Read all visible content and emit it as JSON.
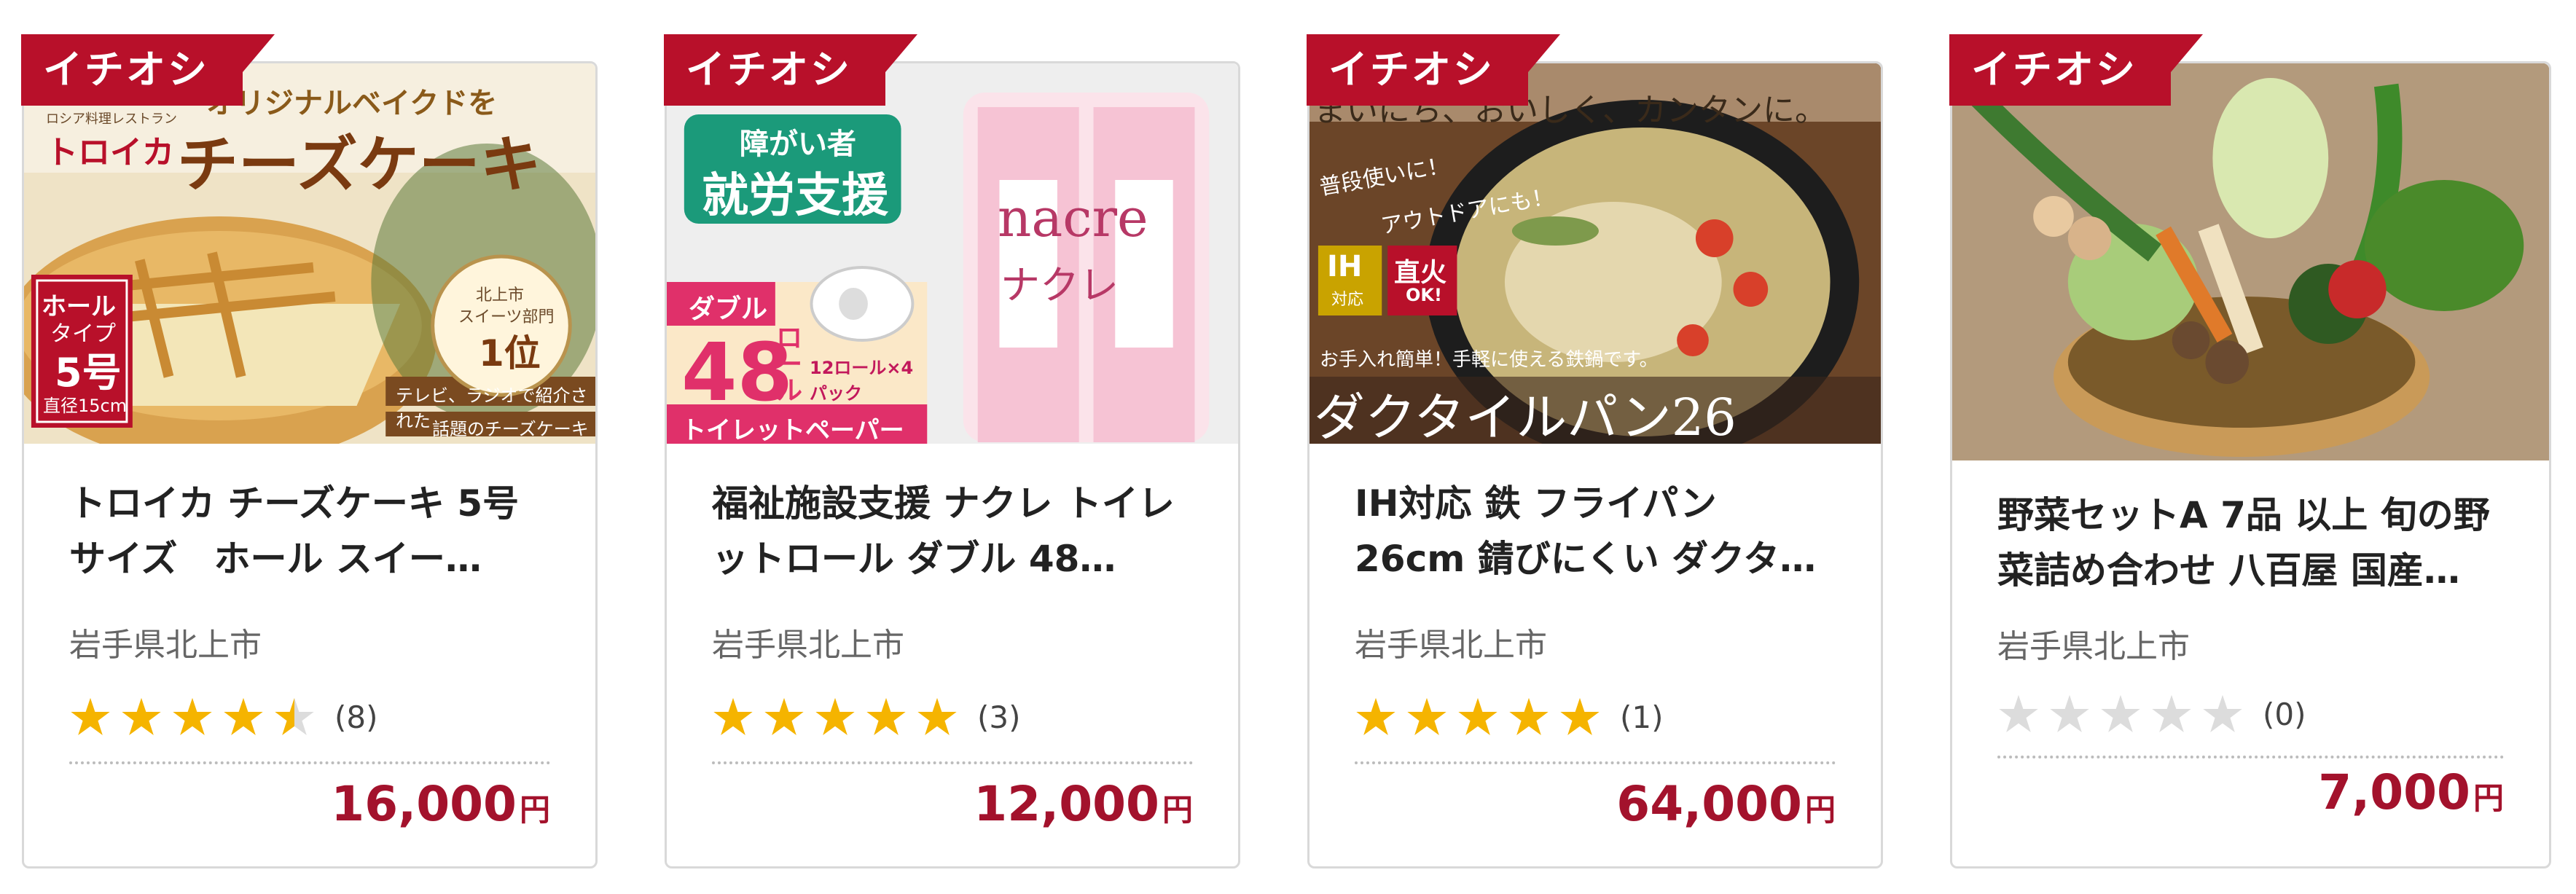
{
  "colors": {
    "accent": "#b8102a",
    "price": "#a3122c",
    "star_on": "#f5b400",
    "star_off": "#dcdcdc"
  },
  "cards": [
    {
      "ribbon": "イチオシ",
      "image_text": [
        "オリジナルベイクドを",
        "トロイカ",
        "チーズケーキ",
        "ロシア料理レストラン",
        "ホール",
        "タイプ",
        "5号",
        "直径15cm",
        "北上市",
        "スイーツ部門",
        "1位",
        "テレビ、ラジオで紹介された",
        "話題のチーズケーキ"
      ],
      "title": "トロイカ チーズケーキ 5号サイズ　ホール スイー…",
      "location": "岩手県北上市",
      "rating": 4.5,
      "review_count": "(8)",
      "price": "16,000",
      "currency": "円"
    },
    {
      "ribbon": "イチオシ",
      "image_text": [
        "障がい者",
        "就労支援",
        "ダブル",
        "48",
        "ロール",
        "12ロール×4パック",
        "トイレットペーパー",
        "nacre",
        "ナクレ"
      ],
      "title": "福祉施設支援 ナクレ トイレットロール ダブル 48…",
      "location": "岩手県北上市",
      "rating": 5,
      "review_count": "(3)",
      "price": "12,000",
      "currency": "円"
    },
    {
      "ribbon": "イチオシ",
      "image_text": [
        "まいにち、おいしく、カンタンに。",
        "普段使いに！",
        "アウトドアにも！",
        "IH",
        "対応",
        "直火",
        "OK!",
        "お手入れ簡単！手軽に使える鉄鍋です。",
        "ダクタイルパン26"
      ],
      "title": "IH対応 鉄 フライパン 26cm 錆びにくい ダクタイ…",
      "location": "岩手県北上市",
      "rating": 5,
      "review_count": "(1)",
      "price": "64,000",
      "currency": "円"
    },
    {
      "ribbon": "イチオシ",
      "image_text": [],
      "title": "野菜セットA 7品 以上 旬の野菜詰め合わせ 八百屋 国産 B0394",
      "location": "岩手県北上市",
      "rating": 0,
      "review_count": "(0)",
      "price": "7,000",
      "currency": "円"
    }
  ]
}
